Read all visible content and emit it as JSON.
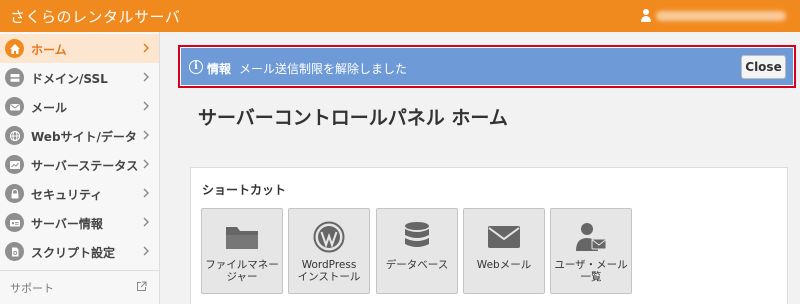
{
  "header": {
    "brand": "さくらのレンタルサーバ"
  },
  "sidebar": {
    "items": [
      {
        "label": "ホーム",
        "icon": "home-icon"
      },
      {
        "label": "ドメイン/SSL",
        "icon": "server-icon"
      },
      {
        "label": "メール",
        "icon": "mail-icon"
      },
      {
        "label": "Webサイト/データ",
        "icon": "globe-icon"
      },
      {
        "label": "サーバーステータス",
        "icon": "chart-icon"
      },
      {
        "label": "セキュリティ",
        "icon": "lock-icon"
      },
      {
        "label": "サーバー情報",
        "icon": "card-icon"
      },
      {
        "label": "スクリプト設定",
        "icon": "script-icon"
      }
    ],
    "support": "サポート"
  },
  "alert": {
    "icon_glyph": "i",
    "title": "情報",
    "message": "メール送信制限を解除しました",
    "close_label": "Close"
  },
  "main": {
    "page_title": "サーバーコントロールパネル ホーム"
  },
  "shortcuts": {
    "title": "ショートカット",
    "tiles": [
      {
        "label": "ファイルマネー\nジャー",
        "icon": "folder-icon"
      },
      {
        "label": "WordPress\nインストール",
        "icon": "wordpress-icon"
      },
      {
        "label": "データベース",
        "icon": "database-icon"
      },
      {
        "label": "Webメール",
        "icon": "envelope-icon"
      },
      {
        "label": "ユーザ・メール\n一覧",
        "icon": "user-mail-icon"
      }
    ]
  },
  "colors": {
    "brand_orange": "#f18a1e",
    "active_bg": "#fde6d0",
    "alert_blue": "#6e9bd8",
    "alert_border": "#d6001c"
  }
}
